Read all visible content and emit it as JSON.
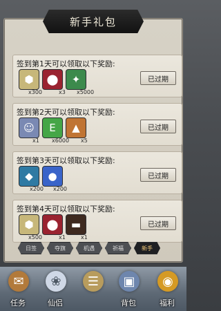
{
  "title": "新手礼包",
  "gifts": [
    {
      "label": "签到第1天可以领取以下奖励:",
      "button": "已过期",
      "rewards": [
        {
          "icon": "silver-ingot-icon",
          "qty": "x300",
          "color": "#c7b77a"
        },
        {
          "icon": "red-potion-icon",
          "qty": "x3",
          "color": "#9a2330"
        },
        {
          "icon": "jade-token-icon",
          "qty": "x5000",
          "color": "#3c8a4c"
        }
      ]
    },
    {
      "label": "签到第2天可以领取以下奖励:",
      "button": "已过期",
      "rewards": [
        {
          "icon": "warrior-portrait-icon",
          "qty": "x1",
          "color": "#7a89b3"
        },
        {
          "icon": "exp-orb-icon",
          "qty": "x6000",
          "color": "#45a647"
        },
        {
          "icon": "bronze-helmet-icon",
          "qty": "x5",
          "color": "#c07433"
        }
      ]
    },
    {
      "label": "签到第3天可以领取以下奖励:",
      "button": "已过期",
      "rewards": [
        {
          "icon": "blue-gem-icon",
          "qty": "x200",
          "color": "#2f7aa3"
        },
        {
          "icon": "blue-orb-icon",
          "qty": "x200",
          "color": "#3a64c9"
        }
      ]
    },
    {
      "label": "签到第4天可以领取以下奖励:",
      "button": "已过期",
      "rewards": [
        {
          "icon": "silver-ingot-icon",
          "qty": "x500",
          "color": "#c7b77a"
        },
        {
          "icon": "red-potion-icon",
          "qty": "x1",
          "color": "#9a2330"
        },
        {
          "icon": "black-hat-icon",
          "qty": "x1",
          "color": "#3e2a20"
        }
      ]
    }
  ],
  "tabs": [
    {
      "label": "日签",
      "active": false
    },
    {
      "label": "夺旗",
      "active": false
    },
    {
      "label": "机遇",
      "active": false
    },
    {
      "label": "祈福",
      "active": false
    },
    {
      "label": "新手",
      "active": true
    }
  ],
  "nav": [
    {
      "label": "任务",
      "icon": "task-scroll-icon",
      "color": "#b27a3b"
    },
    {
      "label": "仙侣",
      "icon": "fairy-companion-icon",
      "color": "#cfd8e6"
    },
    {
      "label": "",
      "icon": "map-scroll-icon",
      "color": "#b89c5d"
    },
    {
      "label": "背包",
      "icon": "backpack-icon",
      "color": "#6e86ad"
    },
    {
      "label": "福利",
      "icon": "fortune-pouch-icon",
      "color": "#d59a24"
    }
  ]
}
